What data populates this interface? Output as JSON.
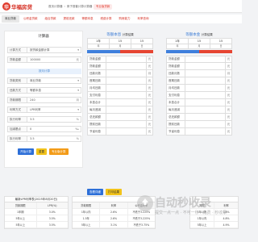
{
  "header": {
    "logo_char": "华",
    "logo_text": "华福房贷",
    "crumbs": [
      "首页计算器",
      "房子首套计算计算器"
    ],
    "crumb_active": "专业版贷款"
  },
  "nav": {
    "items": [
      "商业贷款",
      "公积金贷款",
      "组合贷款",
      "提前还款",
      "等额本息",
      "税费计算",
      "购房能力",
      "利率查询"
    ]
  },
  "left_panel": {
    "title": "计算器",
    "rows": [
      {
        "label": "计算方式",
        "value": "按贷款金额计算",
        "unit": "▾"
      },
      {
        "label": "贷款金额",
        "value": "100000",
        "unit": "元"
      },
      {
        "label": "贷款类别",
        "value": "商业贷款",
        "unit": "▾"
      },
      {
        "label": "还款方式",
        "value": "等额本息",
        "unit": "▾"
      },
      {
        "label": "贷款期限",
        "value": "240",
        "unit": "月"
      },
      {
        "label": "利率方式",
        "value": "LPR利率",
        "unit": "▾"
      },
      {
        "label": "执行利率",
        "value": "3.5",
        "unit": "%"
      },
      {
        "label": "加减基点",
        "value": "0",
        "unit": "‰"
      },
      {
        "label": "执行利率",
        "value": "3.5",
        "unit": "%"
      }
    ],
    "separator": "按月计算",
    "buttons": [
      "开始计算",
      "重置",
      "专业版计算"
    ]
  },
  "right_panel": {
    "col_a_title": "等额本息",
    "col_b_title": "等额本金",
    "col_suffix": "计算结果",
    "term": [
      "1年",
      "15",
      "15"
    ],
    "term_sub": [
      "年",
      "月",
      "日"
    ],
    "rows": [
      {
        "label": "贷款金额",
        "unit": "元"
      },
      {
        "label": "贷款金额",
        "unit": "元"
      },
      {
        "label": "还款月数",
        "unit": "月"
      },
      {
        "label": "首期还款",
        "unit": "元"
      },
      {
        "label": "月均还款",
        "unit": "元"
      },
      {
        "label": "支付利息",
        "unit": "元"
      },
      {
        "label": "本息合计",
        "unit": "元"
      },
      {
        "label": "每月递减",
        "unit": "元"
      },
      {
        "label": "总还款额",
        "unit": "元"
      },
      {
        "label": "提前还款",
        "unit": "元"
      },
      {
        "label": "节省利息",
        "unit": "元"
      }
    ],
    "buttons": [
      "查看详细",
      "打印结果"
    ]
  },
  "bottom": {
    "table1": {
      "title": "最新LPR利率表(2025年8月20日)",
      "header": [
        "贷款期限",
        "LPR(%)"
      ],
      "rows": [
        [
          "1年期",
          "3.0%"
        ],
        [
          "5年以上",
          "3.5%"
        ],
        [
          "5年以上",
          "3.5%"
        ]
      ]
    },
    "table2": {
      "title": "",
      "header": [
        "贷款期限",
        "利率",
        "公积金利率"
      ],
      "rows": [
        [
          "1年以内",
          "2.6%",
          "不低于3.225%"
        ],
        [
          "1-5年",
          "2.6%",
          "不低于3.225%"
        ],
        [
          "5年以上",
          "3.1%",
          "不低于3.75%"
        ]
      ]
    },
    "table3": {
      "title": "",
      "header": [
        "期限",
        "利率"
      ],
      "rows": [
        [
          "1年以内",
          "3.6%"
        ],
        [
          "1年以内",
          "4.8%"
        ],
        [
          "5年以上",
          "4.9%"
        ]
      ]
    }
  },
  "watermark": {
    "title": "自动秒收录",
    "sub": "提交一点一点 · 不可一秒 · 免费 · 秒收录"
  }
}
